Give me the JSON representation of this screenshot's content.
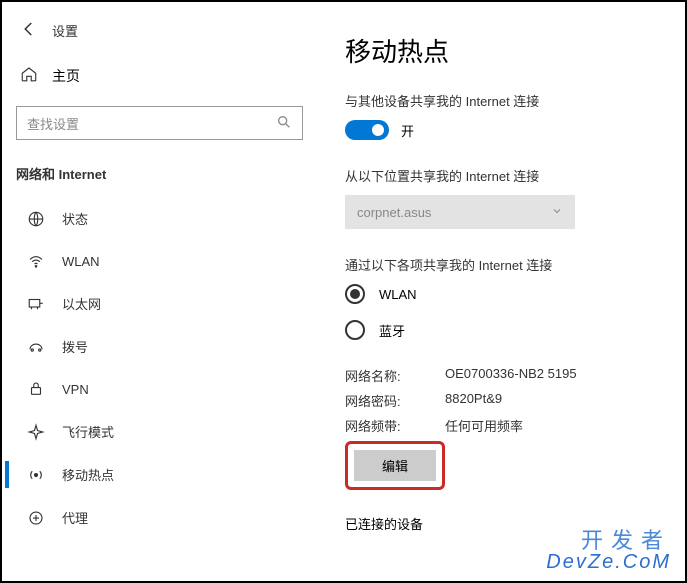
{
  "topbar": {
    "title": "设置"
  },
  "home": {
    "label": "主页"
  },
  "search": {
    "placeholder": "查找设置"
  },
  "section_header": "网络和 Internet",
  "sidebar": {
    "items": [
      {
        "label": "状态"
      },
      {
        "label": "WLAN"
      },
      {
        "label": "以太网"
      },
      {
        "label": "拨号"
      },
      {
        "label": "VPN"
      },
      {
        "label": "飞行模式"
      },
      {
        "label": "移动热点"
      },
      {
        "label": "代理"
      }
    ]
  },
  "main": {
    "title": "移动热点",
    "share_label": "与其他设备共享我的 Internet 连接",
    "toggle_label": "开",
    "share_from_label": "从以下位置共享我的 Internet 连接",
    "share_from_value": "corpnet.asus",
    "share_over_label": "通过以下各项共享我的 Internet 连接",
    "radio_wlan": "WLAN",
    "radio_bt": "蓝牙",
    "net_name_key": "网络名称:",
    "net_name_val": "OE0700336-NB2 5195",
    "net_pass_key": "网络密码:",
    "net_pass_val": "8820Pt&9",
    "net_band_key": "网络频带:",
    "net_band_val": "任何可用频率",
    "edit_label": "编辑",
    "connected_label": "已连接的设备"
  },
  "watermark": {
    "cn": "开发者",
    "en": "DevZe.CoM"
  }
}
